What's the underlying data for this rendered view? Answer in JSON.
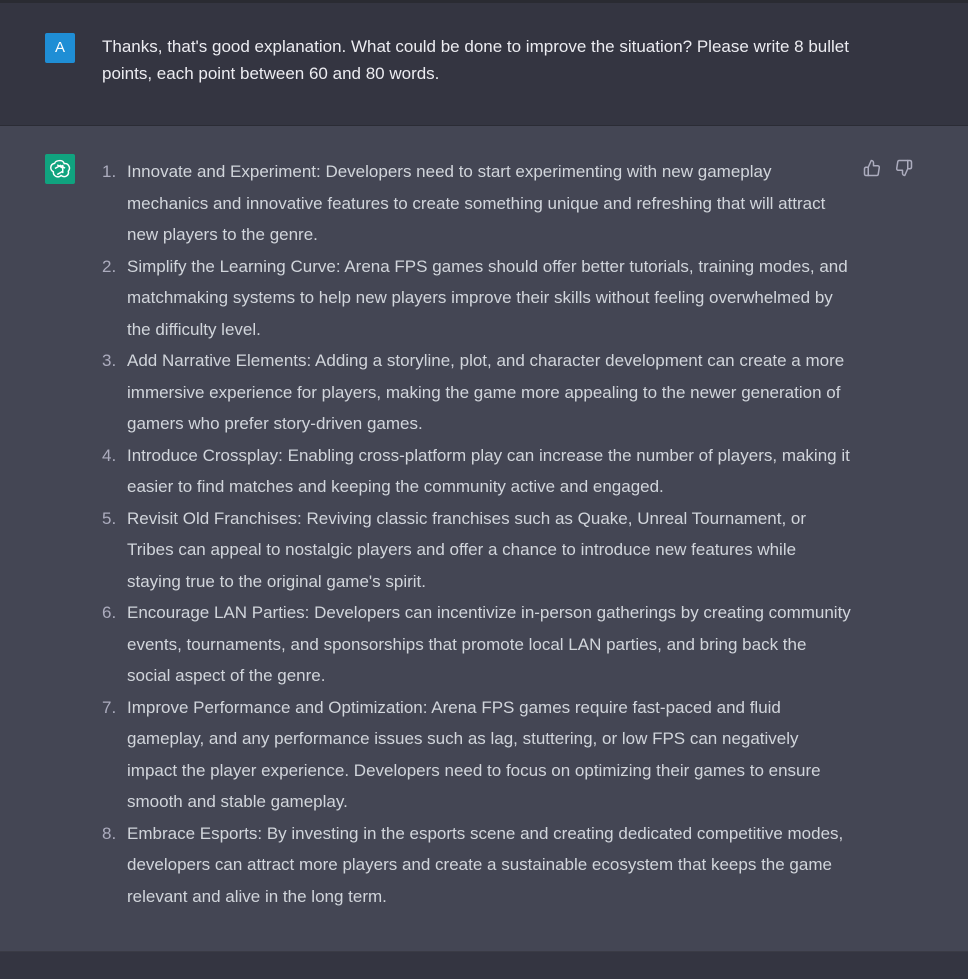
{
  "user_message": {
    "avatar_letter": "A",
    "text": "Thanks, that's good explanation. What could be done to improve the situation? Please write 8 bullet points, each point between 60 and 80 words."
  },
  "assistant_message": {
    "avatar_icon": "openai-logo-icon",
    "feedback_icons": [
      "thumbs-up-icon",
      "thumbs-down-icon"
    ],
    "items": [
      {
        "num": "1.",
        "text": "Innovate and Experiment: Developers need to start experimenting with new gameplay mechanics and innovative features to create something unique and refreshing that will attract new players to the genre."
      },
      {
        "num": "2.",
        "text": "Simplify the Learning Curve: Arena FPS games should offer better tutorials, training modes, and matchmaking systems to help new players improve their skills without feeling overwhelmed by the difficulty level."
      },
      {
        "num": "3.",
        "text": "Add Narrative Elements: Adding a storyline, plot, and character development can create a more immersive experience for players, making the game more appealing to the newer generation of gamers who prefer story-driven games."
      },
      {
        "num": "4.",
        "text": "Introduce Crossplay: Enabling cross-platform play can increase the number of players, making it easier to find matches and keeping the community active and engaged."
      },
      {
        "num": "5.",
        "text": "Revisit Old Franchises: Reviving classic franchises such as Quake, Unreal Tournament, or Tribes can appeal to nostalgic players and offer a chance to introduce new features while staying true to the original game's spirit."
      },
      {
        "num": "6.",
        "text": "Encourage LAN Parties: Developers can incentivize in-person gatherings by creating community events, tournaments, and sponsorships that promote local LAN parties, and bring back the social aspect of the genre."
      },
      {
        "num": "7.",
        "text": "Improve Performance and Optimization: Arena FPS games require fast-paced and fluid gameplay, and any performance issues such as lag, stuttering, or low FPS can negatively impact the player experience. Developers need to focus on optimizing their games to ensure smooth and stable gameplay."
      },
      {
        "num": "8.",
        "text": "Embrace Esports: By investing in the esports scene and creating dedicated competitive modes, developers can attract more players and create a sustainable ecosystem that keeps the game relevant and alive in the long term."
      }
    ]
  },
  "colors": {
    "page_bg": "#343541",
    "assistant_bg": "#444654",
    "user_avatar": "#1f8ed5",
    "assistant_avatar": "#10a37f",
    "text_primary": "#ececf1",
    "text_assistant": "#d1d5db"
  }
}
